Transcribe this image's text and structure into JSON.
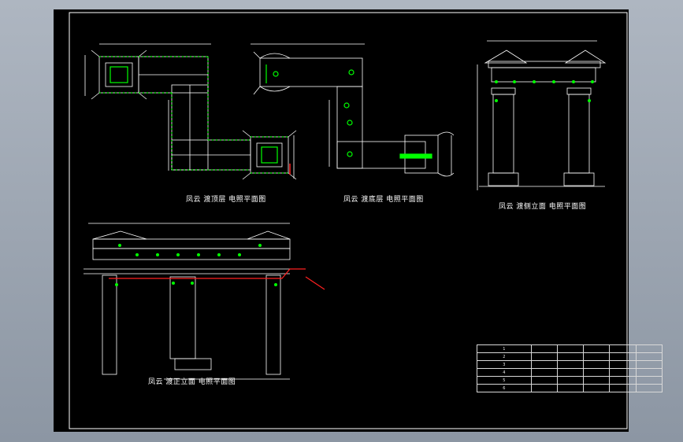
{
  "captions": {
    "top_plan": "凤云 渡顶层 电照平面图",
    "bottom_plan": "凤云 渡底层 电照平面图",
    "side_elev": "凤云 渡侧立面 电照平面图",
    "front_elev": "凤云 渡正立面 电照平面图"
  },
  "table": {
    "rows": [
      [
        "1",
        "",
        "",
        "",
        "",
        ""
      ],
      [
        "2",
        "",
        "",
        "",
        "",
        ""
      ],
      [
        "3",
        "",
        "",
        "",
        "",
        ""
      ],
      [
        "4",
        "",
        "",
        "",
        "",
        ""
      ],
      [
        "5",
        "",
        "",
        "",
        "",
        ""
      ],
      [
        "6",
        "",
        "",
        "",
        "",
        ""
      ]
    ]
  },
  "colors": {
    "background": "#000000",
    "frame": "#ffffff",
    "fixture": "#00ff00",
    "wire": "#ff2020",
    "line": "#ffffff"
  }
}
